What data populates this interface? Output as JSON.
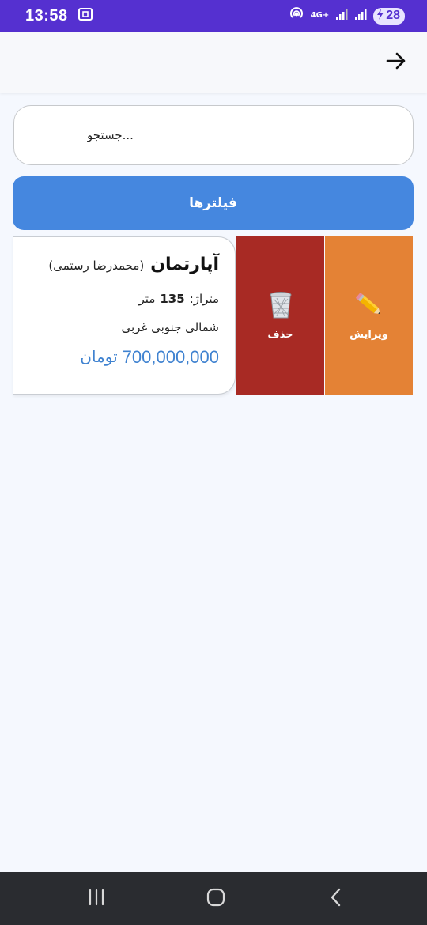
{
  "status_bar": {
    "time": "13:58",
    "network_label": "4G+",
    "battery_level": "28",
    "icons": [
      "screenshot-icon",
      "hotspot-icon",
      "signal-icon",
      "signal-icon",
      "battery-charging-icon"
    ]
  },
  "app_bar": {
    "back_icon": "arrow-right-icon"
  },
  "search": {
    "placeholder": "جستجو..."
  },
  "filters": {
    "label": "فیلترها"
  },
  "listing": {
    "type": "آپارتمان",
    "owner": "(محمدرضا رستمی)",
    "area_label": "متراژ:",
    "area_value": "135",
    "area_unit": "متر",
    "direction": "شمالی جنوبی غربی",
    "price_value": "700,000,000",
    "price_currency": "تومان"
  },
  "actions": {
    "delete_label": "حذف",
    "delete_icon": "trash-icon",
    "delete_color": "#a82a24",
    "edit_label": "ویرایش",
    "edit_icon": "pencil-icon",
    "edit_color": "#e48235"
  },
  "colors": {
    "status_bar": "#5530d0",
    "primary_button": "#4587df",
    "price_text": "#3f82d0"
  },
  "nav_bar": {
    "buttons": [
      "recents-icon",
      "home-icon",
      "back-chevron-icon"
    ]
  }
}
